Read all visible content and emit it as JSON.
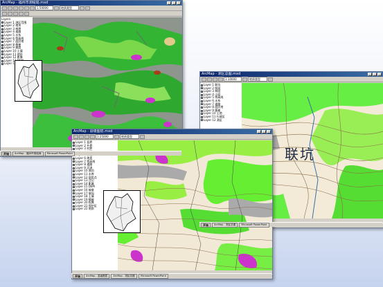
{
  "windows": {
    "w1": {
      "title": "ArcMap - 福州市测绘局.mxd",
      "scale": "1:50000",
      "layer_field": "地质类型",
      "toc_header": "Layers",
      "toc_items": [
        "Layer 1 测区范围",
        "Layer 2 地块",
        "Layer 3 林地",
        "Layer 4 道路",
        "Layer 5 水系",
        "Layer 6 等高线",
        "Layer 7 居民地",
        "Layer 8 植被",
        "Layer 9 坡度",
        "Layer 10 土壤",
        "Layer 11 地形",
        "Layer 12 影像",
        "Layer 13 DEM",
        "Layer 14 边界"
      ],
      "status": [
        "Ready",
        "118.36 25.84",
        "Decimal Degrees"
      ]
    },
    "w2": {
      "title": "ArcMap - 测区总图.mxd",
      "scale": "1:10000",
      "layer_field": "地质类型",
      "toc_items": [
        "Layer 1 联坑",
        "Layer 2 图斑",
        "Layer 3 林班",
        "Layer 4 小班",
        "Layer 5 等高线",
        "Layer 6 水系",
        "Layer 7 道路",
        "Layer 8 居民地",
        "Layer 9 植被",
        "Layer 10 土地",
        "Layer 11 行政区",
        "Layer 12 测区"
      ],
      "status": [
        "Ready",
        "118.32 25.87"
      ]
    },
    "w3": {
      "title": "ArcMap - 县级图层.mxd",
      "scale": "1:25000",
      "layer_field": "地质类型",
      "toc_items": [
        "Layer 1 县界",
        "Layer 2 乡界",
        "Layer 3 村界",
        "Layer 4 林班",
        "Layer 5 小班",
        "Layer 6 地类",
        "Layer 7 等高线",
        "Layer 8 道路",
        "Layer 9 河流",
        "Layer 10 湖泊",
        "Layer 11 水库",
        "Layer 12 居民点",
        "Layer 13 注记",
        "Layer 14 影像",
        "Layer 15 DEM",
        "Layer 16 坡度",
        "Layer 17 坡向",
        "Layer 18 土壤",
        "Layer 19 植被",
        "Layer 20 权属",
        "Layer 21 保护区",
        "Layer 22 地质"
      ],
      "status": [
        "Ready",
        "118.30 25.80"
      ]
    }
  },
  "map_label": "联坑",
  "taskbar": {
    "start": "开始",
    "items": [
      "ArcMap - 福州市测绘局",
      "ArcMap - 测区总图",
      "ArcMap - 县级图层",
      "Microsoft PowerPoint"
    ]
  },
  "colors": {
    "map_green": "#33cc33",
    "map_light_green": "#99ee55",
    "map_magenta": "#cc33cc",
    "map_tan": "#e8d9b5",
    "map_grey": "#9a9a9a",
    "desktop": "#c6d3ee"
  }
}
